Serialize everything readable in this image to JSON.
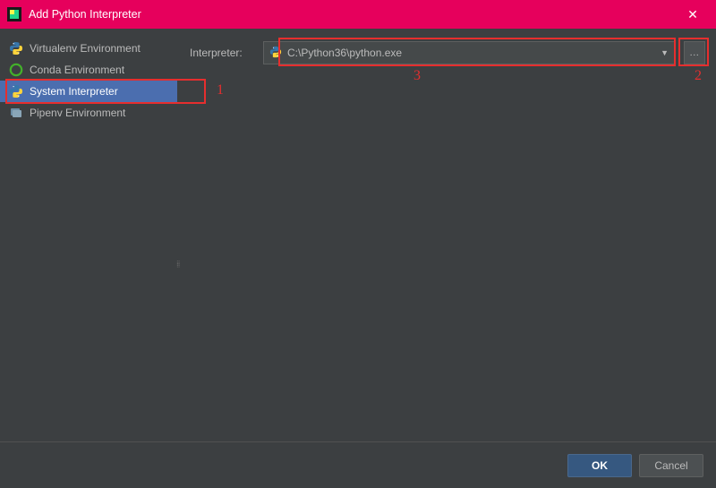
{
  "titlebar": {
    "title": "Add Python Interpreter",
    "close_glyph": "✕"
  },
  "sidebar": {
    "items": [
      {
        "label": "Virtualenv Environment",
        "icon": "python-icon",
        "selected": false
      },
      {
        "label": "Conda Environment",
        "icon": "conda-icon",
        "selected": false
      },
      {
        "label": "System Interpreter",
        "icon": "python-icon",
        "selected": true
      },
      {
        "label": "Pipenv Environment",
        "icon": "pipenv-icon",
        "selected": false
      }
    ]
  },
  "form": {
    "interpreter_label": "Interpreter:",
    "interpreter_value": "C:\\Python36\\python.exe",
    "browse_glyph": "..."
  },
  "buttons": {
    "ok": "OK",
    "cancel": "Cancel"
  },
  "annotations": {
    "num1": "1",
    "num2": "2",
    "num3": "3"
  }
}
